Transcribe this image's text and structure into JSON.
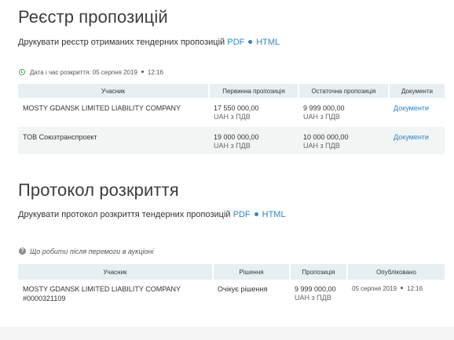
{
  "registry": {
    "title": "Реєстр пропозицій",
    "print_text": "Друкувати реєстр отриманих тендерних пропозицій",
    "pdf_label": "PDF",
    "html_label": "HTML",
    "opening_label": "Дата і час розкриття: 05 серпня 2019",
    "opening_time": "12:16",
    "headers": [
      "Учасник",
      "Первинна пропозиція",
      "Остаточна пропозиція",
      "Документи"
    ],
    "rows": [
      {
        "participant": "MOSTY GDANSK LIMITED LIABILITY COMPANY",
        "initial_amount": "17 550 000,00",
        "initial_unit": "UAH з ПДВ",
        "final_amount": "9 999 000,00",
        "final_unit": "UAH з ПДВ",
        "docs_label": "Документи"
      },
      {
        "participant": "ТОВ Союзтранспроект",
        "initial_amount": "19 000 000,00",
        "initial_unit": "UAH з ПДВ",
        "final_amount": "10 000 000,00",
        "final_unit": "UAH з ПДВ",
        "docs_label": "Документи"
      }
    ]
  },
  "protocol": {
    "title": "Протокол розкриття",
    "print_text": "Друкувати протокол розкриття тендерних пропозицій",
    "pdf_label": "PDF",
    "html_label": "HTML",
    "help_text": "Що робити після перемоги в аукціоні",
    "headers": [
      "Учасник",
      "Рішення",
      "Пропозиція",
      "Опубліковано"
    ],
    "rows": [
      {
        "participant_line1": "MOSTY GDANSK LIMITED LIABILITY COMPANY",
        "participant_line2": "#0000321109",
        "decision": "Очікує рішення",
        "offer_amount": "9 999 000,00",
        "offer_unit": "UAH з ПДВ",
        "published_date": "05 серпня 2019",
        "published_time": "12:16"
      }
    ]
  },
  "colors": {
    "link": "#2f87c6",
    "header_bg": "#e7eff3",
    "clock_green": "#4caf50"
  }
}
